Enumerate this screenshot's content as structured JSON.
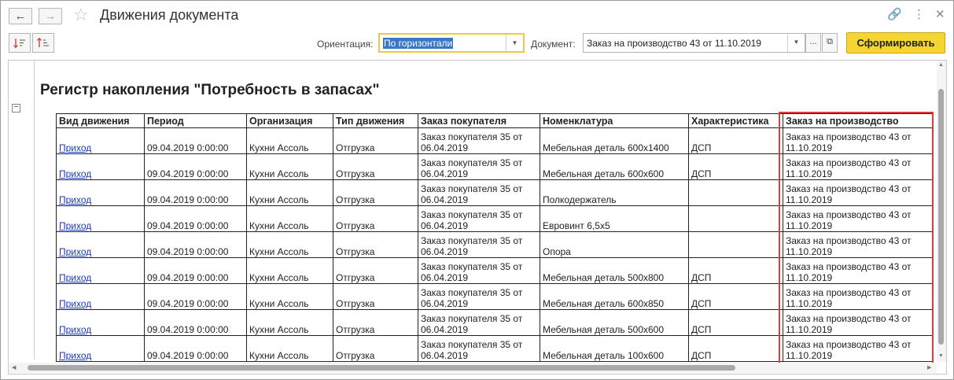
{
  "window": {
    "title": "Движения документа",
    "back_icon": "←",
    "forward_icon": "→",
    "star_icon": "☆",
    "link_icon": "🔗",
    "more_icon": "⋮",
    "close_icon": "✕"
  },
  "toolbar": {
    "orientation_label": "Ориентация:",
    "orientation_value": "По горизонтали",
    "document_label": "Документ:",
    "document_value": "Заказ на производство 43 от 11.10.2019",
    "ellipsis": "...",
    "generate_label": "Сформировать"
  },
  "report": {
    "title": "Регистр накопления \"Потребность в запасах\"",
    "columns": [
      "Вид движения",
      "Период",
      "Организация",
      "Тип движения",
      "Заказ покупателя",
      "Номенклатура",
      "Характеристика",
      "Заказ на производство"
    ],
    "rows": [
      [
        "Приход",
        "09.04.2019 0:00:00",
        "Кухни Ассоль",
        "Отгрузка",
        "Заказ покупателя 35 от 06.04.2019",
        "Мебельная деталь 600х1400",
        "ДСП",
        "Заказ на производство 43 от 11.10.2019"
      ],
      [
        "Приход",
        "09.04.2019 0:00:00",
        "Кухни Ассоль",
        "Отгрузка",
        "Заказ покупателя 35 от 06.04.2019",
        "Мебельная деталь 600х600",
        "ДСП",
        "Заказ на производство 43 от 11.10.2019"
      ],
      [
        "Приход",
        "09.04.2019 0:00:00",
        "Кухни Ассоль",
        "Отгрузка",
        "Заказ покупателя 35 от 06.04.2019",
        "Полкодержатель",
        "",
        "Заказ на производство 43 от 11.10.2019"
      ],
      [
        "Приход",
        "09.04.2019 0:00:00",
        "Кухни Ассоль",
        "Отгрузка",
        "Заказ покупателя 35 от 06.04.2019",
        "Евровинт 6,5х5",
        "",
        "Заказ на производство 43 от 11.10.2019"
      ],
      [
        "Приход",
        "09.04.2019 0:00:00",
        "Кухни Ассоль",
        "Отгрузка",
        "Заказ покупателя 35 от 06.04.2019",
        "Опора",
        "",
        "Заказ на производство 43 от 11.10.2019"
      ],
      [
        "Приход",
        "09.04.2019 0:00:00",
        "Кухни Ассоль",
        "Отгрузка",
        "Заказ покупателя 35 от 06.04.2019",
        "Мебельная деталь 500х800",
        "ДСП",
        "Заказ на производство 43 от 11.10.2019"
      ],
      [
        "Приход",
        "09.04.2019 0:00:00",
        "Кухни Ассоль",
        "Отгрузка",
        "Заказ покупателя 35 от 06.04.2019",
        "Мебельная деталь 600х850",
        "ДСП",
        "Заказ на производство 43 от 11.10.2019"
      ],
      [
        "Приход",
        "09.04.2019 0:00:00",
        "Кухни Ассоль",
        "Отгрузка",
        "Заказ покупателя 35 от 06.04.2019",
        "Мебельная деталь 500х600",
        "ДСП",
        "Заказ на производство 43 от 11.10.2019"
      ],
      [
        "Приход",
        "09.04.2019 0:00:00",
        "Кухни Ассоль",
        "Отгрузка",
        "Заказ покупателя 35 от 06.04.2019",
        "Мебельная деталь 100х600",
        "ДСП",
        "Заказ на производство 43 от 11.10.2019"
      ]
    ]
  },
  "colors": {
    "accent_yellow": "#f6d433",
    "focus_border": "#f2c744",
    "highlight_red": "#e03a3a",
    "link_blue": "#1b3bb5"
  }
}
